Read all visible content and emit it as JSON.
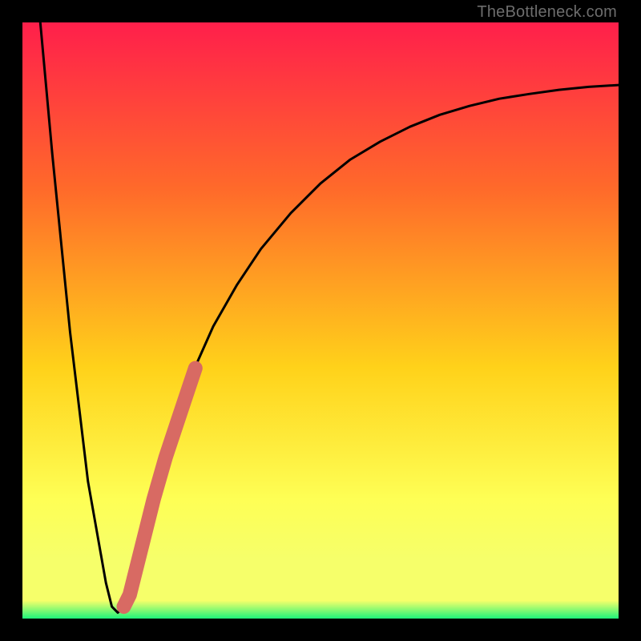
{
  "watermark": "TheBottleneck.com",
  "colors": {
    "frame": "#000000",
    "grad_top": "#ff1f4b",
    "grad_mid_upper": "#ff6a2a",
    "grad_mid": "#ffd21a",
    "grad_lower": "#feff55",
    "grad_yellow_band": "#f6ff6a",
    "grad_green": "#1df57a",
    "curve": "#000000",
    "accent_segment": "#d86a63"
  },
  "chart_data": {
    "type": "line",
    "title": "",
    "xlabel": "",
    "ylabel": "",
    "xlim": [
      0,
      100
    ],
    "ylim": [
      0,
      100
    ],
    "series": [
      {
        "name": "bottleneck-curve",
        "x": [
          3,
          5,
          8,
          11,
          14,
          15,
          16,
          17,
          18,
          20,
          22,
          25,
          28,
          32,
          36,
          40,
          45,
          50,
          55,
          60,
          65,
          70,
          75,
          80,
          85,
          90,
          95,
          100
        ],
        "y": [
          100,
          78,
          48,
          23,
          6,
          2,
          1,
          2,
          6,
          14,
          22,
          31,
          40,
          49,
          56,
          62,
          68,
          73,
          77,
          80,
          82.5,
          84.5,
          86,
          87.2,
          88,
          88.7,
          89.2,
          89.5
        ]
      },
      {
        "name": "highlight-segment",
        "x": [
          17,
          18,
          20,
          22,
          24,
          26,
          28,
          29
        ],
        "y": [
          2,
          4,
          12,
          20,
          27,
          33,
          39,
          42
        ]
      }
    ],
    "annotations": []
  }
}
